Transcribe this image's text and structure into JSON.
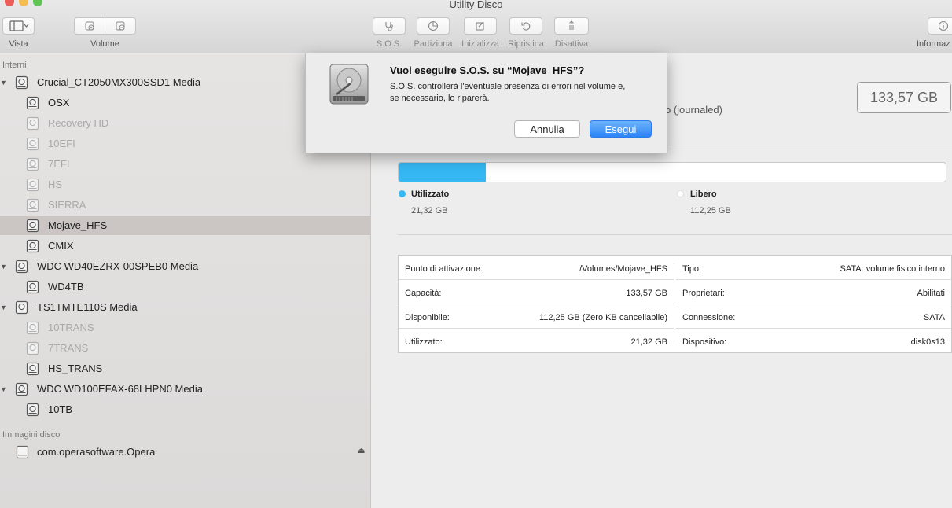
{
  "window": {
    "title": "Utility Disco"
  },
  "toolbar": {
    "vista_label": "Vista",
    "volume_label": "Volume",
    "sos_label": "S.O.S.",
    "partiziona_label": "Partiziona",
    "inizializza_label": "Inizializza",
    "ripristina_label": "Ripristina",
    "disattiva_label": "Disattiva",
    "informazioni_label": "Informaz"
  },
  "sidebar": {
    "section_internal": "Interni",
    "section_images": "Immagini disco",
    "items": [
      {
        "label": "Crucial_CT2050MX300SSD1 Media",
        "kind": "disk",
        "dim": false
      },
      {
        "label": "OSX",
        "kind": "volume",
        "dim": false
      },
      {
        "label": "Recovery HD",
        "kind": "volume",
        "dim": true
      },
      {
        "label": "10EFI",
        "kind": "volume",
        "dim": true
      },
      {
        "label": "7EFI",
        "kind": "volume",
        "dim": true
      },
      {
        "label": "HS",
        "kind": "volume",
        "dim": true
      },
      {
        "label": "SIERRA",
        "kind": "volume",
        "dim": true
      },
      {
        "label": "Mojave_HFS",
        "kind": "volume",
        "dim": false,
        "selected": true
      },
      {
        "label": "CMIX",
        "kind": "volume",
        "dim": false
      },
      {
        "label": "WDC WD40EZRX-00SPEB0 Media",
        "kind": "disk",
        "dim": false
      },
      {
        "label": "WD4TB",
        "kind": "volume",
        "dim": false
      },
      {
        "label": "TS1TMTE110S Media",
        "kind": "disk",
        "dim": false
      },
      {
        "label": "10TRANS",
        "kind": "volume",
        "dim": true
      },
      {
        "label": "7TRANS",
        "kind": "volume",
        "dim": true
      },
      {
        "label": "HS_TRANS",
        "kind": "volume",
        "dim": false
      },
      {
        "label": "WDC WD100EFAX-68LHPN0 Media",
        "kind": "disk",
        "dim": false
      },
      {
        "label": "10TB",
        "kind": "volume",
        "dim": false
      }
    ],
    "image_item": {
      "label": "com.operasoftware.Opera"
    }
  },
  "main": {
    "format_partial": "o (journaled)",
    "capacity_box": "133,57 GB",
    "usage": {
      "used_fraction": 0.16,
      "used_label": "Utilizzato",
      "used_value": "21,32 GB",
      "free_label": "Libero",
      "free_value": "112,25 GB",
      "used_color": "#35b8f4"
    },
    "info_left": [
      {
        "key": "Punto di attivazione:",
        "value": "/Volumes/Mojave_HFS"
      },
      {
        "key": "Capacità:",
        "value": "133,57 GB"
      },
      {
        "key": "Disponibile:",
        "value": "112,25 GB (Zero KB cancellabile)"
      },
      {
        "key": "Utilizzato:",
        "value": "21,32 GB"
      }
    ],
    "info_right": [
      {
        "key": "Tipo:",
        "value": "SATA: volume fisico interno"
      },
      {
        "key": "Proprietari:",
        "value": "Abilitati"
      },
      {
        "key": "Connessione:",
        "value": "SATA"
      },
      {
        "key": "Dispositivo:",
        "value": "disk0s13"
      }
    ]
  },
  "dialog": {
    "title": "Vuoi eseguire S.O.S. su “Mojave_HFS”?",
    "message_line1": "S.O.S. controllerà l'eventuale presenza di errori nel volume e,",
    "message_line2": "se necessario, lo riparerà.",
    "cancel_label": "Annulla",
    "ok_label": "Esegui",
    "icon": "hard-drive-icon"
  }
}
